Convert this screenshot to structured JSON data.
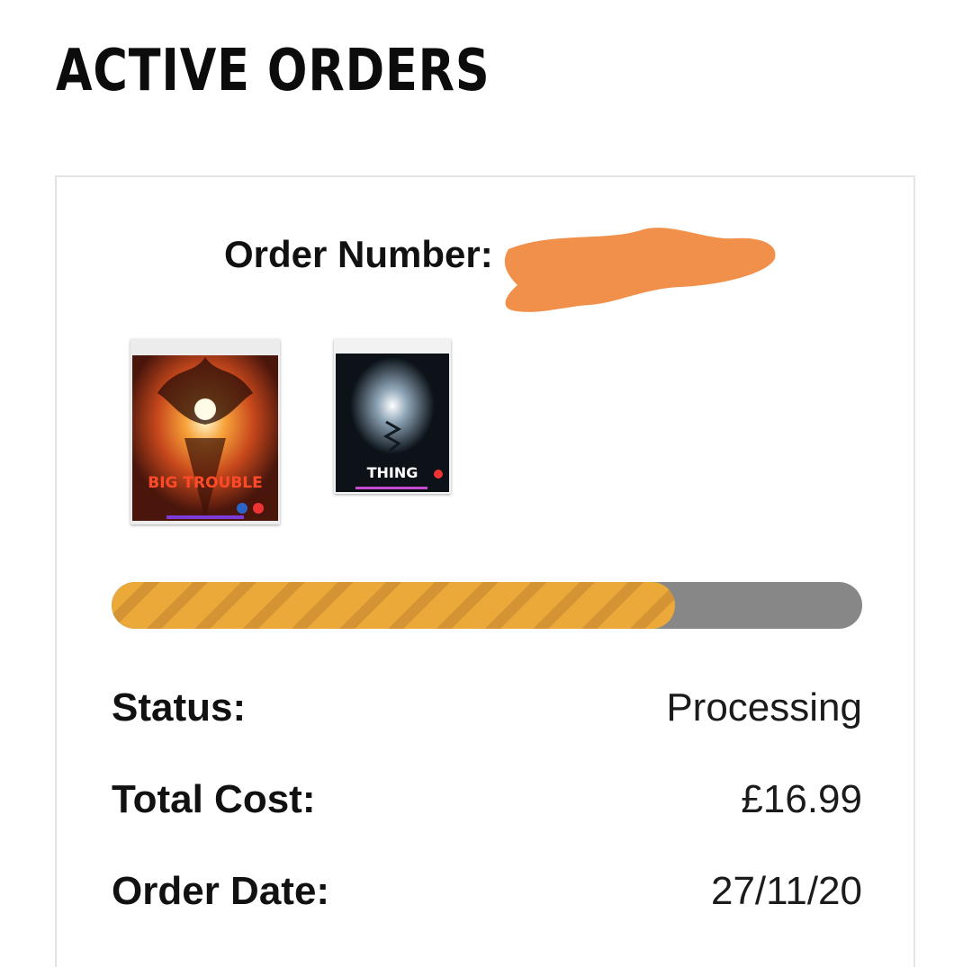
{
  "page": {
    "title": "ACTIVE ORDERS"
  },
  "order": {
    "number_label": "Order Number:",
    "redaction_color": "#f0904a",
    "products": [
      {
        "name": "Big Trouble in Little China",
        "cover_text": "BIG TROUBLE"
      },
      {
        "name": "The Thing",
        "cover_text": "THING"
      }
    ],
    "progress": {
      "percent": 75,
      "fill_color": "#eba93a",
      "track_color": "#878787"
    },
    "details": {
      "status_label": "Status:",
      "status_value": "Processing",
      "total_label": "Total Cost:",
      "total_value": "£16.99",
      "date_label": "Order Date:",
      "date_value": "27/11/20"
    }
  }
}
